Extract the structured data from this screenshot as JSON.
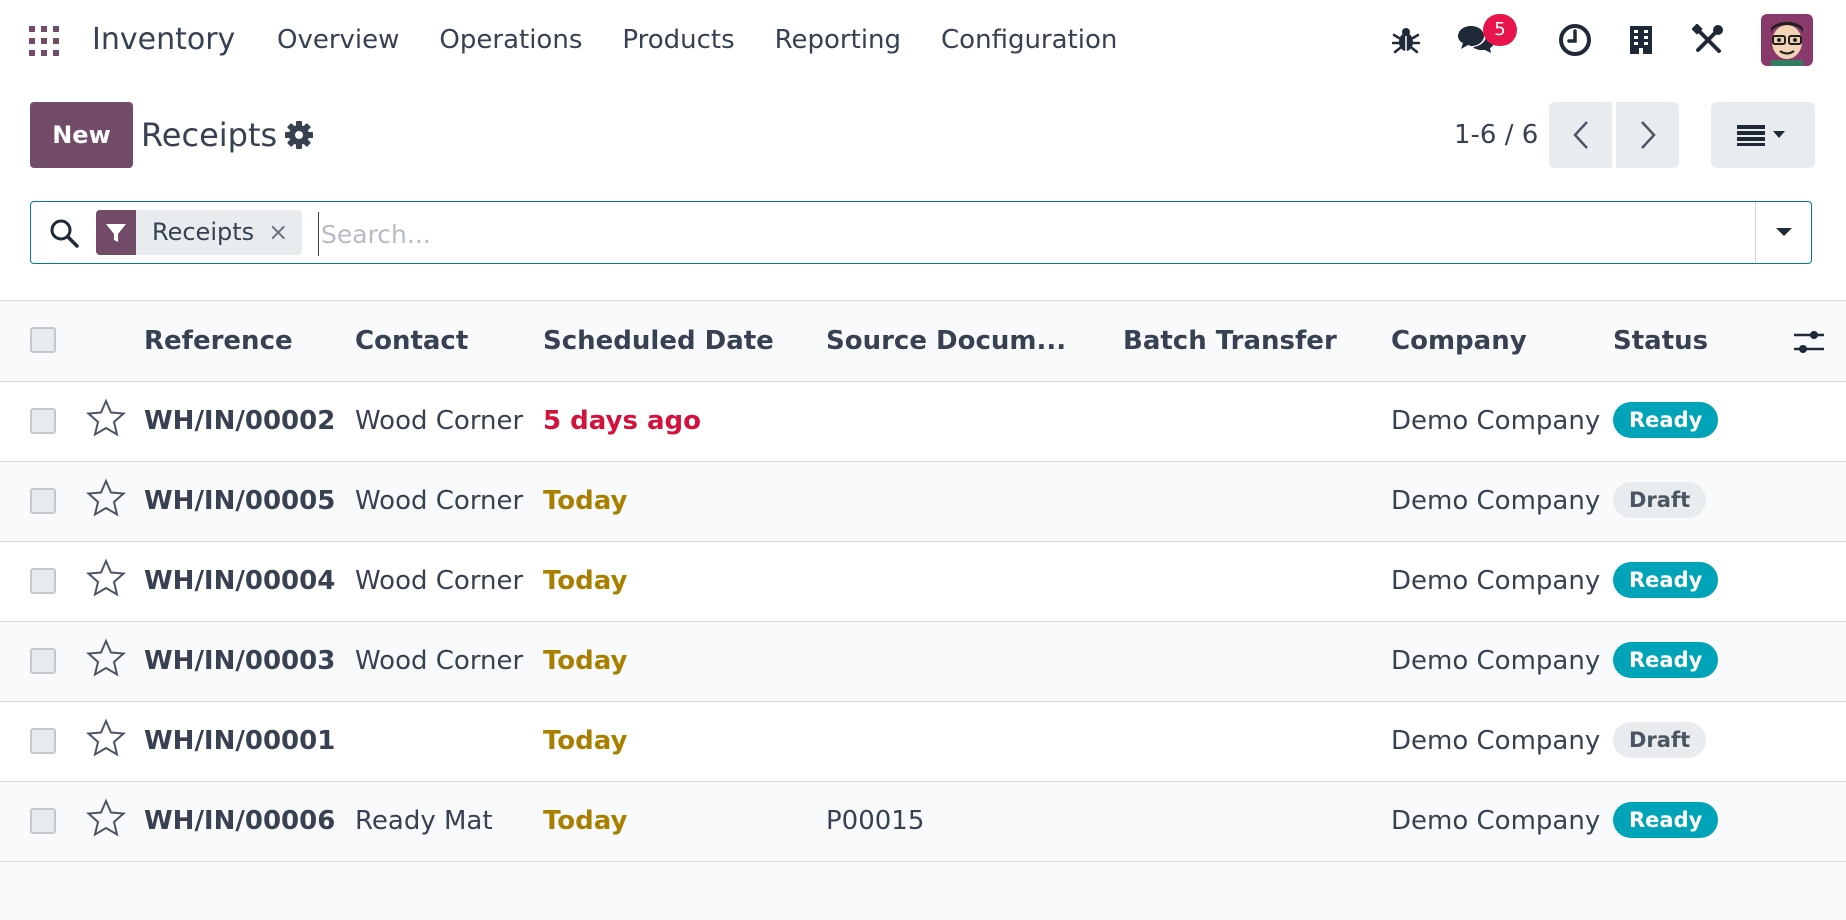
{
  "navbar": {
    "app_name": "Inventory",
    "menu": [
      "Overview",
      "Operations",
      "Products",
      "Reporting",
      "Configuration"
    ],
    "icons": [
      "apps-grid-icon",
      "bug-icon",
      "chat-icon",
      "clock-icon",
      "building-icon",
      "tools-icon"
    ],
    "chat_badge": "5"
  },
  "control": {
    "new_label": "New",
    "title": "Receipts",
    "pager": "1-6 / 6"
  },
  "search": {
    "facet_label": "Receipts",
    "facet_remove": "×",
    "placeholder": "Search..."
  },
  "table": {
    "headers": [
      "Reference",
      "Contact",
      "Scheduled Date",
      "Source Docum...",
      "Batch Transfer",
      "Company",
      "Status"
    ],
    "rows": [
      {
        "reference": "WH/IN/00002",
        "contact": "Wood Corner",
        "date": "5 days ago",
        "date_state": "late",
        "source": "",
        "batch": "",
        "company": "Demo Company",
        "status": "Ready"
      },
      {
        "reference": "WH/IN/00005",
        "contact": "Wood Corner",
        "date": "Today",
        "date_state": "today",
        "source": "",
        "batch": "",
        "company": "Demo Company",
        "status": "Draft"
      },
      {
        "reference": "WH/IN/00004",
        "contact": "Wood Corner",
        "date": "Today",
        "date_state": "today",
        "source": "",
        "batch": "",
        "company": "Demo Company",
        "status": "Ready"
      },
      {
        "reference": "WH/IN/00003",
        "contact": "Wood Corner",
        "date": "Today",
        "date_state": "today",
        "source": "",
        "batch": "",
        "company": "Demo Company",
        "status": "Ready"
      },
      {
        "reference": "WH/IN/00001",
        "contact": "",
        "date": "Today",
        "date_state": "today",
        "source": "",
        "batch": "",
        "company": "Demo Company",
        "status": "Draft"
      },
      {
        "reference": "WH/IN/00006",
        "contact": "Ready Mat",
        "date": "Today",
        "date_state": "today",
        "source": "P00015",
        "batch": "",
        "company": "Demo Company",
        "status": "Ready"
      }
    ]
  },
  "colors": {
    "brand": "#714b67",
    "accent": "#017e84",
    "late": "#d4113c",
    "today": "#a97f00",
    "ready_bg": "#00a3b8",
    "draft_bg": "#e9ecef",
    "badge": "#e8154c"
  }
}
